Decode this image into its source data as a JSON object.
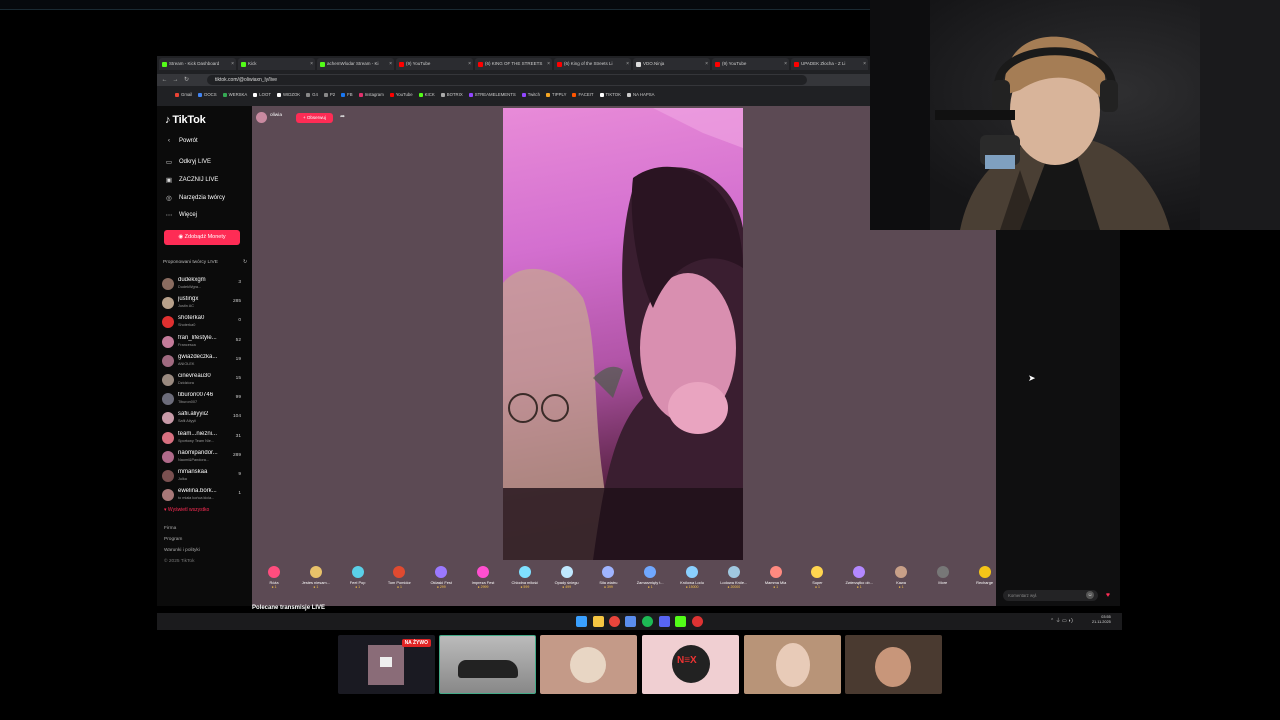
{
  "browser": {
    "tabs": [
      {
        "label": "Stream - Kick Dashboard",
        "color": "#53fc18"
      },
      {
        "label": "Kick",
        "color": "#53fc18"
      },
      {
        "label": "achemWlodar Stream - Ki",
        "color": "#53fc18"
      },
      {
        "label": "(9) YouTube",
        "color": "#ff0000"
      },
      {
        "label": "(6) KING OF THE STREETS",
        "color": "#ff0000"
      },
      {
        "label": "(6) King of the Streets Li",
        "color": "#ff0000"
      },
      {
        "label": "VDO.Ninja",
        "color": "#dddddd"
      },
      {
        "label": "(9) YouTube",
        "color": "#ff0000"
      },
      {
        "label": "UPADEK Złocha - Z Li",
        "color": "#ff0000"
      }
    ],
    "url": "tiktok.com/@oliwiaxn_ly/live",
    "bookmarks": [
      {
        "label": "Gmail",
        "color": "#ea4335"
      },
      {
        "label": "DOCS",
        "color": "#4285f4"
      },
      {
        "label": "WERSKA",
        "color": "#34a853"
      },
      {
        "label": "LOOT",
        "color": "#ffffff"
      },
      {
        "label": "WIDZOK",
        "color": "#ffffff"
      },
      {
        "label": "G4",
        "color": "#888888"
      },
      {
        "label": "P2",
        "color": "#888888"
      },
      {
        "label": "FB",
        "color": "#1877f2"
      },
      {
        "label": "Instagram",
        "color": "#e1306c"
      },
      {
        "label": "YouTube",
        "color": "#ff0000"
      },
      {
        "label": "KICK",
        "color": "#53fc18"
      },
      {
        "label": "BOTRIX",
        "color": "#aaaaaa"
      },
      {
        "label": "STREAMELEMENTS",
        "color": "#9146ff"
      },
      {
        "label": "Twitch",
        "color": "#9146ff"
      },
      {
        "label": "TIPPLY",
        "color": "#f5a623"
      },
      {
        "label": "FACEIT",
        "color": "#ff5500"
      },
      {
        "label": "TIKTOK",
        "color": "#ffffff"
      },
      {
        "label": "NA HAPSA",
        "color": "#cccccc"
      }
    ]
  },
  "sidebar": {
    "logo": "TikTok",
    "back": "Powrót",
    "nav": [
      {
        "label": "Odkryj LIVE",
        "icon": "tv-icon"
      },
      {
        "label": "ZACZNIJ LIVE",
        "icon": "camera-icon"
      },
      {
        "label": "Narzędzia twórcy",
        "icon": "lightbulb-icon"
      },
      {
        "label": "Więcej",
        "icon": "more-icon"
      }
    ],
    "coin_button": "Zdobądź Monety",
    "suggested_title": "Proponowani twórcy LIVE",
    "creators": [
      {
        "name": "dudekxgm",
        "sub": "DudekWgra...",
        "count": "3"
      },
      {
        "name": "justingx",
        "sub": "Justin AC",
        "count": "285"
      },
      {
        "name": "shoterka0",
        "sub": "Shoterka0",
        "count": "0"
      },
      {
        "name": "fran_lifestyle...",
        "sub": "Francesca",
        "count": "52"
      },
      {
        "name": "gwiazdeczka...",
        "sub": "ANIOLEK",
        "count": "19"
      },
      {
        "name": "cinevreau30",
        "sub": "Dzidziora",
        "count": "15"
      },
      {
        "name": "tiburon00746",
        "sub": "Tiburon007",
        "count": "99"
      },
      {
        "name": "safii.aliyyii2",
        "sub": "Safii Aliyyii",
        "count": "104"
      },
      {
        "name": "team...niezni...",
        "sub": "Sportowy Team Nie...",
        "count": "31"
      },
      {
        "name": "naomipandor...",
        "sub": "Naomi&Pandora...",
        "count": "289"
      },
      {
        "name": "mmanskaa",
        "sub": "Julka",
        "count": "9"
      },
      {
        "name": "ewelina.bork...",
        "sub": "to miała końca kicia...",
        "count": "1"
      }
    ],
    "show_all": "Wyświetl wszystko",
    "footer": [
      "Firma",
      "Program",
      "Warunki i polityki",
      "© 2025 TikTok"
    ]
  },
  "stream": {
    "host": "oliwia",
    "follow": "+ Obserwuj"
  },
  "gifts": [
    {
      "name": "Róża",
      "price": "1",
      "color": "#ff4d7e"
    },
    {
      "name": "Jestes niesam...",
      "price": "1",
      "color": "#e8c26a"
    },
    {
      "name": "Feel Pop",
      "price": "1",
      "color": "#5ad0e8"
    },
    {
      "name": "Tom Pomidor",
      "price": "1",
      "color": "#e04a30"
    },
    {
      "name": "Oklaski Fest",
      "price": "299",
      "color": "#9b79ff"
    },
    {
      "name": "Impreza Fest",
      "price": "2999",
      "color": "#ff4fd0"
    },
    {
      "name": "Chłodna miłość",
      "price": "599",
      "color": "#7fe0ff"
    },
    {
      "name": "Opady śniegu",
      "price": "499",
      "color": "#bfe8ff"
    },
    {
      "name": "Siła wiatru",
      "price": "399",
      "color": "#9fb4ff"
    },
    {
      "name": "Zamarznięty t...",
      "price": "1",
      "color": "#70a8ff"
    },
    {
      "name": "Królowa Lodu",
      "price": "15000",
      "color": "#8ad0ff"
    },
    {
      "name": "Lodowa Króle...",
      "price": "20000",
      "color": "#a0c8e0"
    },
    {
      "name": "Mamma Mia",
      "price": "1",
      "color": "#ff8a80"
    },
    {
      "name": "Super",
      "price": "1",
      "color": "#ffd54f"
    },
    {
      "name": "Zwierzątko ob...",
      "price": "1",
      "color": "#b388ff"
    },
    {
      "name": "Kawa",
      "price": "1",
      "color": "#c8a088"
    },
    {
      "name": "More",
      "price": "",
      "color": "#777777"
    },
    {
      "name": "Recharge",
      "price": "",
      "color": "#f5c518"
    }
  ],
  "recommended_title": "Polecane transmisje LIVE",
  "comment_placeholder": "Komentarz wył.",
  "clock": {
    "time": "03:55",
    "date": "21.11.2025"
  },
  "live_badge": "NA ŻYWO"
}
